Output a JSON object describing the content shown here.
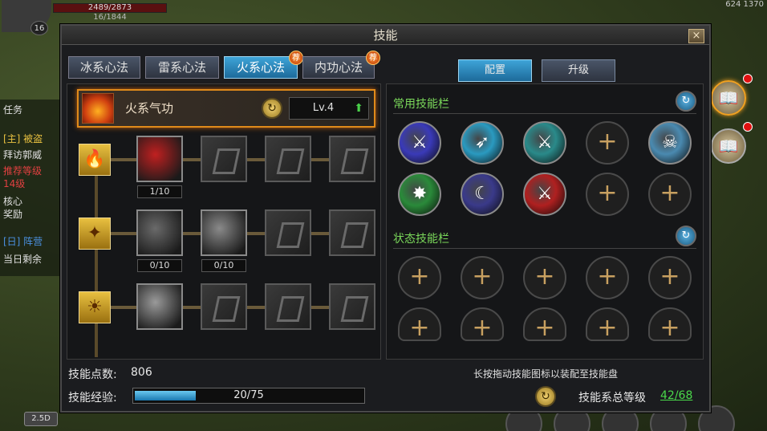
{
  "hud": {
    "hp": "2489/2873",
    "mp": "16/1844",
    "level": "16",
    "coord": "624 1370",
    "mode": "2.5D"
  },
  "quests": [
    {
      "text": "任务",
      "color": "#e0e0e0"
    },
    {
      "text": "[主] 被盗",
      "color": "#e8c040"
    },
    {
      "text": "拜访郭威",
      "color": "#e0e0e0"
    },
    {
      "text": "推荐等级",
      "color": "#e04040"
    },
    {
      "text": "14级",
      "color": "#e04040"
    },
    {
      "text": "核心",
      "color": "#e0e0e0"
    },
    {
      "text": "奖励",
      "color": "#e0e0e0"
    },
    {
      "text": "[日] 阵营",
      "color": "#4a90e0"
    },
    {
      "text": "当日剩余",
      "color": "#e0e0e0"
    }
  ],
  "dialog": {
    "title": "技能",
    "close_icon": "×",
    "tabs": [
      {
        "label": "冰系心法",
        "active": false,
        "badge": ""
      },
      {
        "label": "雷系心法",
        "active": false,
        "badge": ""
      },
      {
        "label": "火系心法",
        "active": true,
        "badge": "荐"
      },
      {
        "label": "内功心法",
        "active": false,
        "badge": "荐"
      }
    ],
    "right_tabs": {
      "config": "配置",
      "upgrade": "升级"
    },
    "school": {
      "name": "火系气功",
      "level": "Lv.4",
      "swap_icon": "↻",
      "up_icon": "⬆"
    },
    "tree": [
      {
        "type_icon": "🔥",
        "skills": [
          {
            "state": "learned",
            "count": "1/10",
            "color": "#c02020"
          },
          {
            "state": "locked",
            "count": ""
          },
          {
            "state": "locked",
            "count": ""
          },
          {
            "state": "locked",
            "count": ""
          }
        ]
      },
      {
        "type_icon": "✦",
        "skills": [
          {
            "state": "available",
            "count": "0/10",
            "color": "#6a6a6a"
          },
          {
            "state": "available",
            "count": "0/10",
            "color": "#8a8a8a"
          },
          {
            "state": "locked",
            "count": ""
          },
          {
            "state": "locked",
            "count": ""
          }
        ]
      },
      {
        "type_icon": "☀",
        "skills": [
          {
            "state": "available",
            "count": "",
            "color": "#9a9a9a"
          },
          {
            "state": "locked",
            "count": ""
          },
          {
            "state": "locked",
            "count": ""
          },
          {
            "state": "locked",
            "count": ""
          }
        ]
      }
    ],
    "common_bar": {
      "title": "常用技能栏",
      "slots": [
        {
          "filled": true,
          "color": "#3a3ab8",
          "glyph": "⚔"
        },
        {
          "filled": true,
          "color": "#2a9ac0",
          "glyph": "➶"
        },
        {
          "filled": true,
          "color": "#2a8a8a",
          "glyph": "⚔"
        },
        {
          "filled": false
        },
        {
          "filled": true,
          "color": "#4a8ab0",
          "glyph": "☠"
        },
        {
          "filled": true,
          "color": "#2a8a3a",
          "glyph": "✸"
        },
        {
          "filled": true,
          "color": "#3a3a8a",
          "glyph": "☾"
        },
        {
          "filled": true,
          "color": "#b02020",
          "glyph": "⚔"
        },
        {
          "filled": false
        },
        {
          "filled": false
        }
      ]
    },
    "status_bar": {
      "title": "状态技能栏",
      "slot_count": 10
    },
    "plus": "+",
    "refresh_icon": "↻",
    "hint": "长按拖动技能图标以装配至技能盘",
    "skill_points_label": "技能点数:",
    "skill_points": "806",
    "exp_label": "技能经验:",
    "exp_text": "20/75",
    "exp_fraction": 0.267,
    "total_label": "技能系总等级",
    "total_value": "42/68"
  }
}
